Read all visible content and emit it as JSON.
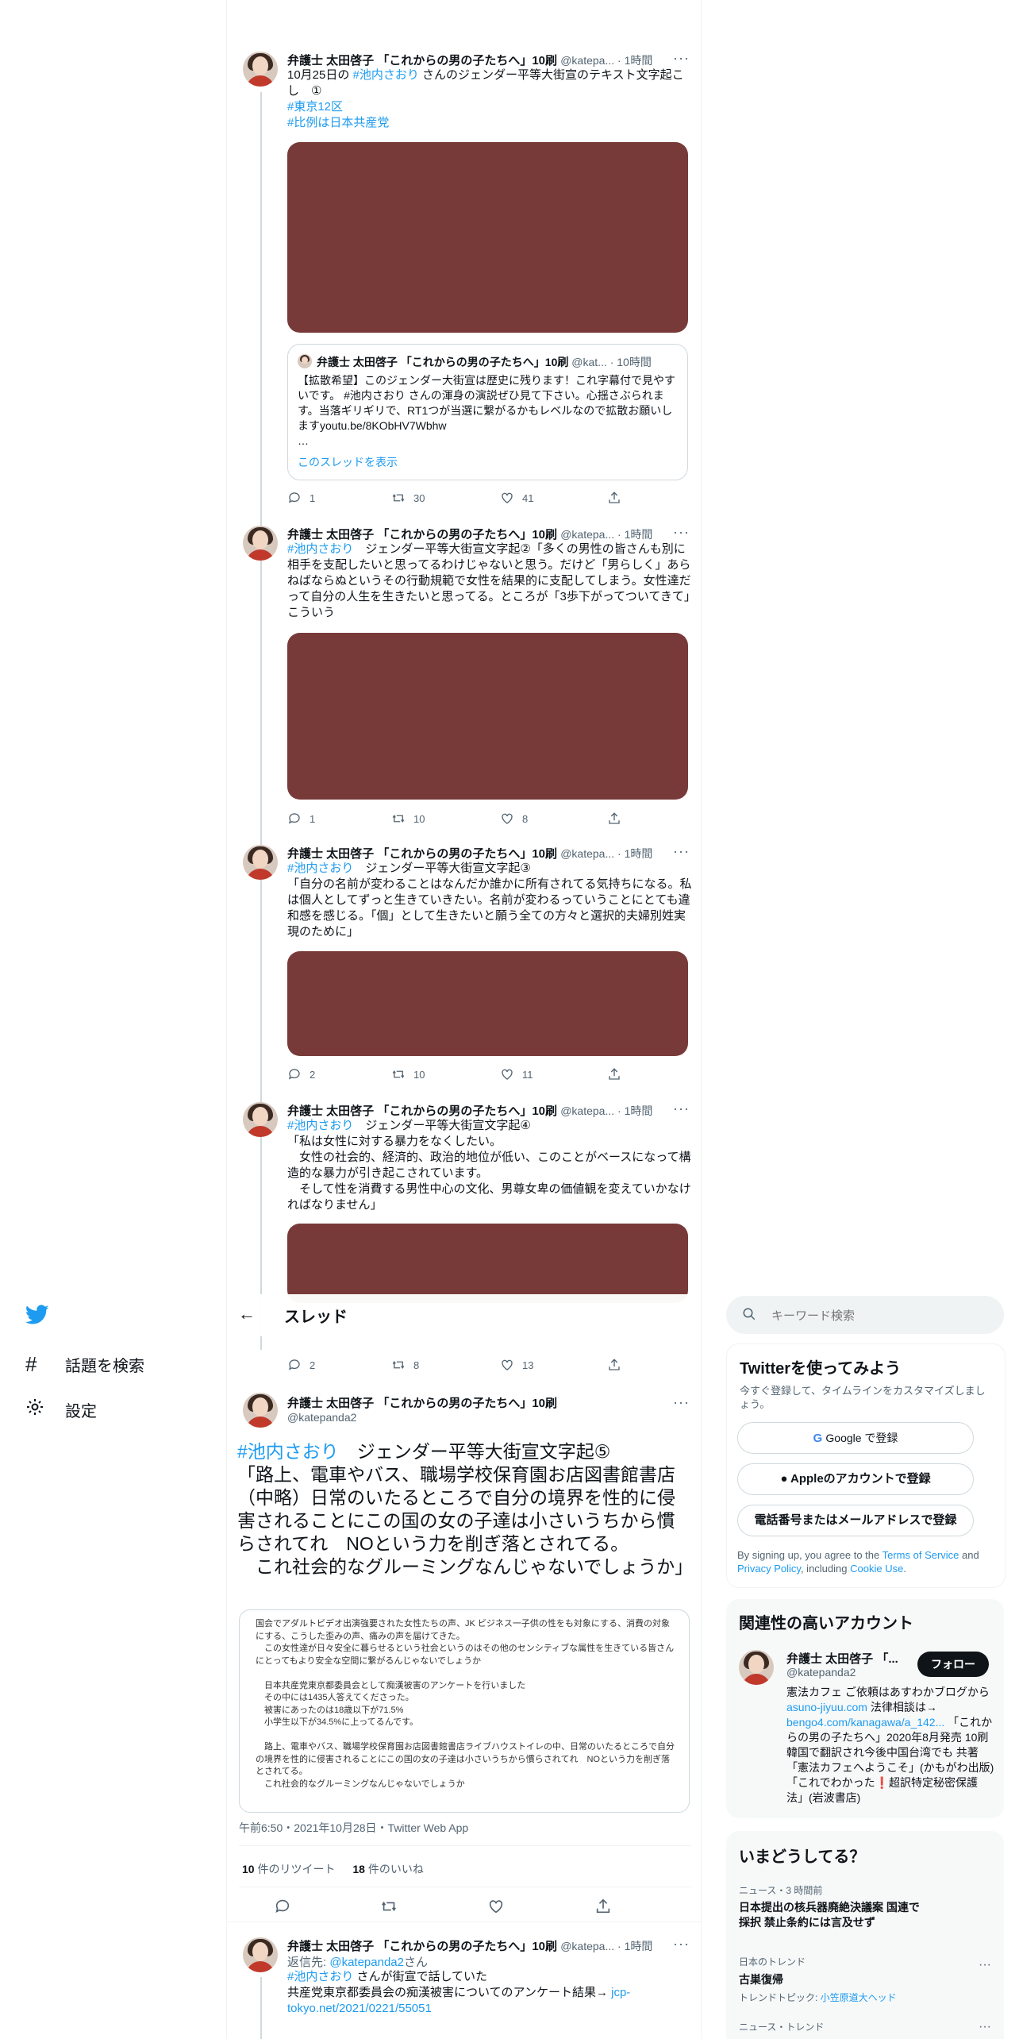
{
  "app": {
    "accent": "#1d9bf0",
    "media_color": "#773a38"
  },
  "nav": {
    "explore": "話題を検索",
    "settings": "設定"
  },
  "header": {
    "title": "スレッド"
  },
  "search": {
    "placeholder": "キーワード検索"
  },
  "author": {
    "name": "弁護士 太田啓子 「これからの男の子たちへ」10刷",
    "handle_short": "@katepa...",
    "handle": "@katepanda2",
    "time": "1時間"
  },
  "tweets": [
    {
      "text_pre": "10月25日の ",
      "mention": "#池内さおり",
      "text_post": " さんのジェンダー平等大街宣のテキスト文字起こし　①",
      "tag1": "#東京12区",
      "tag2": "#比例は日本共産党",
      "replies": "1",
      "retweets": "30",
      "likes": "41"
    },
    {
      "mention": "#池内さおり",
      "text": "　ジェンダー平等大街宣文字起②「多くの男性の皆さんも別に相手を支配したいと思ってるわけじゃないと思う。だけど「男らしく」あらねばならぬというその行動規範で女性を結果的に支配してしまう。女性達だって自分の人生を生きたいと思ってる。ところが「3歩下がってついてきて」こういう",
      "replies": "1",
      "retweets": "10",
      "likes": "8"
    },
    {
      "mention": "#池内さおり",
      "text": "　ジェンダー平等大街宣文字起③\n「自分の名前が変わることはなんだか誰かに所有されてる気持ちになる。私は個人としてずっと生きていきたい。名前が変わるっていうことにとても違和感を感じる。「個」として生きたいと願う全ての方々と選択的夫婦別姓実現のために」",
      "replies": "2",
      "retweets": "10",
      "likes": "11"
    },
    {
      "mention": "#池内さおり",
      "text": "　ジェンダー平等大街宣文字起④\n「私は女性に対する暴力をなくしたい。\n　女性の社会的、経済的、政治的地位が低い、このことがベースになって構造的な暴力が引き起こされています。\n　そして性を消費する男性中心の文化、男尊女卑の価値観を変えていかなければなりません」",
      "replies": "2",
      "retweets": "8",
      "likes": "13"
    }
  ],
  "quote": {
    "name": "弁護士 太田啓子 「これからの男の子たちへ」10刷",
    "handle": "@kat...",
    "time": "10時間",
    "text": "【拡散希望】このジェンダー大街宣は歴史に残ります！これ字幕付で見やすいです。 #池内さおり さんの渾身の演説ぜひ見て下さい。心揺さぶられます。当落ギリギリで、RT1つが当選に繋がるかもレベルなので拡散お願いしますyoutu.be/8KObHV7Wbhw\n…",
    "show_thread": "このスレッドを表示"
  },
  "main": {
    "mention": "#池内さおり",
    "text": "　ジェンダー平等大街宣文字起⑤\n「路上、電車やバス、職場学校保育園お店図書館書店（中略）日常のいたるところで自分の境界を性的に侵害されることにこの国の女の子達は小さいうちから慣らされてれ　NOという力を削ぎ落とされてる。\n　これ社会的なグルーミングなんじゃないでしょうか」",
    "image_text": "国会でアダルトビデオ出演強要された女性たちの声、JK ビジネス一子供の性をも対象にする、消費の対象にする、こうした歪みの声、痛みの声を届けてきた。\n　この女性達が日々安全に暮らせるという社会というのはその他のセンシティブな属性を生きている皆さんにとってもより安全な空間に繋がるんじゃないでしょうか\n\n　日本共産党東京都委員会として痴漢被害のアンケートを行いました\n　その中には1435人答えてくださった。\n　被害にあったのは18歳以下が71.5%\n　小学生以下が34.5%に上ってるんです。\n\n　路上、電車やバス、職場学校保育園お店図書館書店ライブハウストイレの中、日常のいたるところで自分の境界を性的に侵害されることにこの国の女の子達は小さいうちから慣らされてれ　NOという力を削ぎ落とされてる。\n　これ社会的なグルーミングなんじゃないでしょうか",
    "timestamp": "午前6:50・2021年10月28日・Twitter Web App",
    "rt_count": "10",
    "rt_label": " 件のリツイート",
    "like_count": "18",
    "like_label": " 件のいいね"
  },
  "reply": {
    "reply_to": "返信先: ",
    "reply_handle": "@katepanda2",
    "reply_suffix": "さん",
    "mention": "#池内さおり",
    "text1": " さんが街宣で話していた",
    "text2": "共産党東京都委員会の痴漢被害についてのアンケート結果→ ",
    "link": "jcp-tokyo.net/2021/0221/55051"
  },
  "signup": {
    "title": "Twitterを使ってみよう",
    "desc": "今すぐ登録して、タイムラインをカスタマイズしましょう。",
    "google": "Google で登録",
    "apple": "Appleのアカウントで登録",
    "phone": "電話番号またはメールアドレスで登録",
    "legal1": "By signing up, you agree to the ",
    "tos": "Terms of Service",
    "legal2": " and ",
    "privacy": "Privacy Policy",
    "legal3": ", including ",
    "cookie": "Cookie Use",
    "legal4": "."
  },
  "relevant": {
    "title": "関連性の高いアカウント",
    "name": "弁護士 太田啓子 「...",
    "handle": "@katepanda2",
    "follow": "フォロー",
    "bio1": "憲法カフェ ご依頼はあすわかブログから ",
    "bio_link1": "asuno-jiyuu.com",
    "bio2": " 法律相談は→ ",
    "bio_link2": "bengo4.com/kanagawa/a_142...",
    "bio3": " 「これからの男の子たちへ」2020年8月発売 10刷 韓国で翻訳され今後中国台湾でも 共著「憲法カフェへようこそ」(かもがわ出版)「これでわかった",
    "bio_emoji": "❗",
    "bio4": "超訳特定秘密保護法」(岩波書店)"
  },
  "trends": {
    "title": "いまどうしてる？",
    "items": [
      {
        "meta": "ニュース・3 時間前",
        "name": "日本提出の核兵器廃絶決議案 国連で採択 禁止条約には言及せず"
      },
      {
        "meta": "日本のトレンド",
        "name": "古巣復帰",
        "sub_pre": "トレンドトピック: ",
        "sub_link": "小笠原道大ヘッド"
      },
      {
        "meta": "ニュース・トレンド",
        "name": ""
      }
    ]
  }
}
